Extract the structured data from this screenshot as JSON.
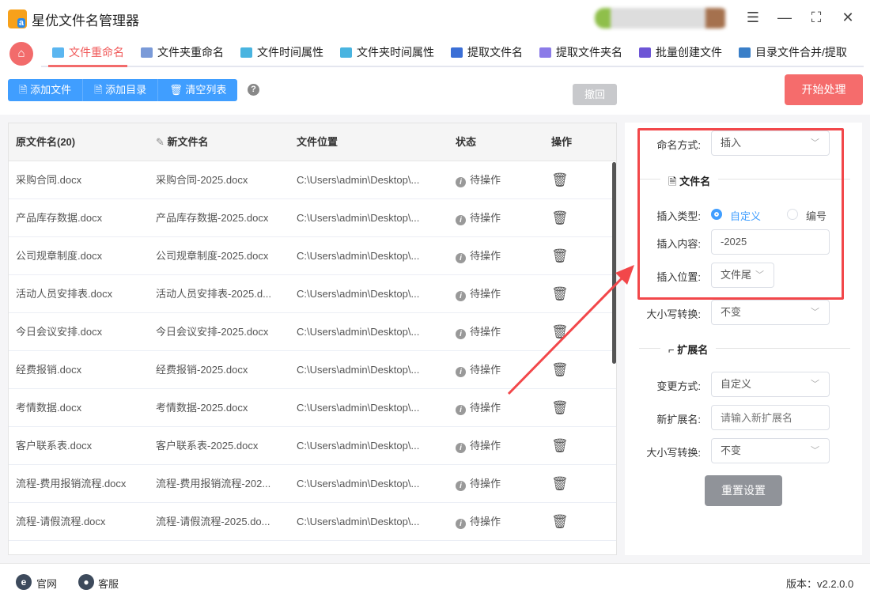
{
  "app": {
    "title": "星优文件名管理器",
    "logo_text": "ba"
  },
  "window": {
    "settings": "settings",
    "minimize": "minimize",
    "maximize": "maximize",
    "close": "close"
  },
  "nav": {
    "tabs": [
      {
        "label": "文件重命名",
        "color": "#5bb6f0"
      },
      {
        "label": "文件夹重命名",
        "color": "#7a9ad8"
      },
      {
        "label": "文件时间属性",
        "color": "#49b4e0"
      },
      {
        "label": "文件夹时间属性",
        "color": "#49b4e0"
      },
      {
        "label": "提取文件名",
        "color": "#3b6fd6"
      },
      {
        "label": "提取文件夹名",
        "color": "#8b7be8"
      },
      {
        "label": "批量创建文件",
        "color": "#6d55d6"
      },
      {
        "label": "目录文件合并/提取",
        "color": "#3a7fc8"
      }
    ]
  },
  "toolbar": {
    "add_file": "添加文件",
    "add_dir": "添加目录",
    "clear_list": "清空列表",
    "help": "?",
    "undo": "撤回",
    "start": "开始处理"
  },
  "table": {
    "headers": [
      "原文件名(20)",
      "新文件名",
      "文件位置",
      "状态",
      "操作"
    ],
    "rows": [
      [
        "采购合同.docx",
        "采购合同-2025.docx",
        "C:\\Users\\admin\\Desktop\\...",
        "待操作"
      ],
      [
        "产品库存数据.docx",
        "产品库存数据-2025.docx",
        "C:\\Users\\admin\\Desktop\\...",
        "待操作"
      ],
      [
        "公司规章制度.docx",
        "公司规章制度-2025.docx",
        "C:\\Users\\admin\\Desktop\\...",
        "待操作"
      ],
      [
        "活动人员安排表.docx",
        "活动人员安排表-2025.d...",
        "C:\\Users\\admin\\Desktop\\...",
        "待操作"
      ],
      [
        "今日会议安排.docx",
        "今日会议安排-2025.docx",
        "C:\\Users\\admin\\Desktop\\...",
        "待操作"
      ],
      [
        "经费报销.docx",
        "经费报销-2025.docx",
        "C:\\Users\\admin\\Desktop\\...",
        "待操作"
      ],
      [
        "考情数据.docx",
        "考情数据-2025.docx",
        "C:\\Users\\admin\\Desktop\\...",
        "待操作"
      ],
      [
        "客户联系表.docx",
        "客户联系表-2025.docx",
        "C:\\Users\\admin\\Desktop\\...",
        "待操作"
      ],
      [
        "流程-费用报销流程.docx",
        "流程-费用报销流程-202...",
        "C:\\Users\\admin\\Desktop\\...",
        "待操作"
      ],
      [
        "流程-请假流程.docx",
        "流程-请假流程-2025.do...",
        "C:\\Users\\admin\\Desktop\\...",
        "待操作"
      ]
    ]
  },
  "panel": {
    "naming_label": "命名方式:",
    "naming_value": "插入",
    "filename_section": "文件名",
    "insert_type_label": "插入类型:",
    "insert_type_custom": "自定义",
    "insert_type_number": "编号",
    "insert_content_label": "插入内容:",
    "insert_content_value": "-2025",
    "insert_pos_label": "插入位置:",
    "insert_pos_value": "文件尾",
    "case_label": "大小写转换:",
    "case_value": "不变",
    "ext_section": "扩展名",
    "ext_change_label": "变更方式:",
    "ext_change_value": "自定义",
    "new_ext_label": "新扩展名:",
    "new_ext_placeholder": "请输入新扩展名",
    "ext_case_label": "大小写转换:",
    "ext_case_value": "不变",
    "reset": "重置设置"
  },
  "footer": {
    "website": "官网",
    "support": "客服",
    "version": "版本：v2.2.0.0"
  },
  "colors": {
    "accent": "#f26b6b",
    "primary": "#409eff",
    "highlight": "#f2474a"
  }
}
